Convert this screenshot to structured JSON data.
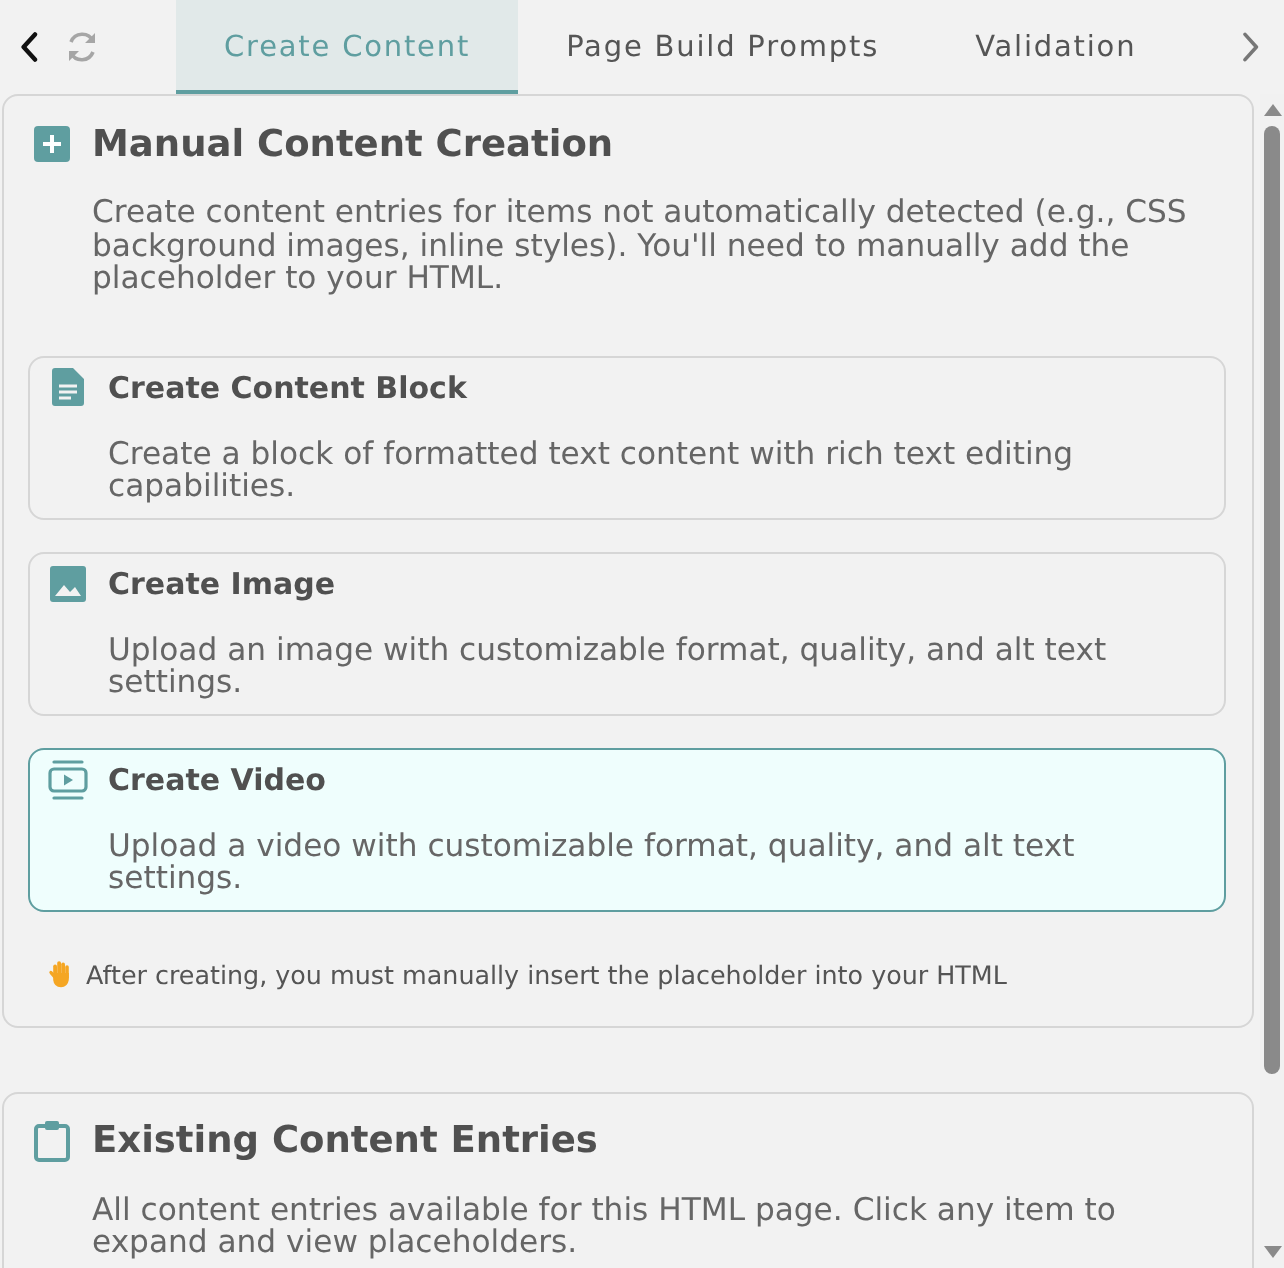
{
  "toolbar": {
    "refresh": {
      "disabled": true
    }
  },
  "tabs": [
    {
      "label": "Create Content",
      "selected": true
    },
    {
      "label": "Page Build Prompts",
      "selected": false
    },
    {
      "label": "Validation",
      "selected": false
    }
  ],
  "sections": [
    {
      "kind": "create",
      "title": "Manual Content Creation",
      "description": "Create content entries for items not automatically detected (e.g., CSS background images, inline styles). You'll need to manually add the placeholder to your HTML.",
      "options": [
        {
          "kind": "text",
          "title": "Create Content Block",
          "description": "Create a block of formatted text content with rich text editing capabilities.",
          "selected": false
        },
        {
          "kind": "image",
          "title": "Create Image",
          "description": "Upload an image with customizable format, quality, and alt text settings.",
          "selected": false
        },
        {
          "kind": "video",
          "title": "Create Video",
          "description": "Upload a video with customizable format, quality, and alt text settings.",
          "selected": true
        }
      ],
      "note": "After creating, you must manually insert the placeholder into your HTML"
    },
    {
      "kind": "list",
      "title": "Existing Content Entries",
      "description": "All content entries available for this HTML page. Click any item to expand and view placeholders."
    }
  ]
}
